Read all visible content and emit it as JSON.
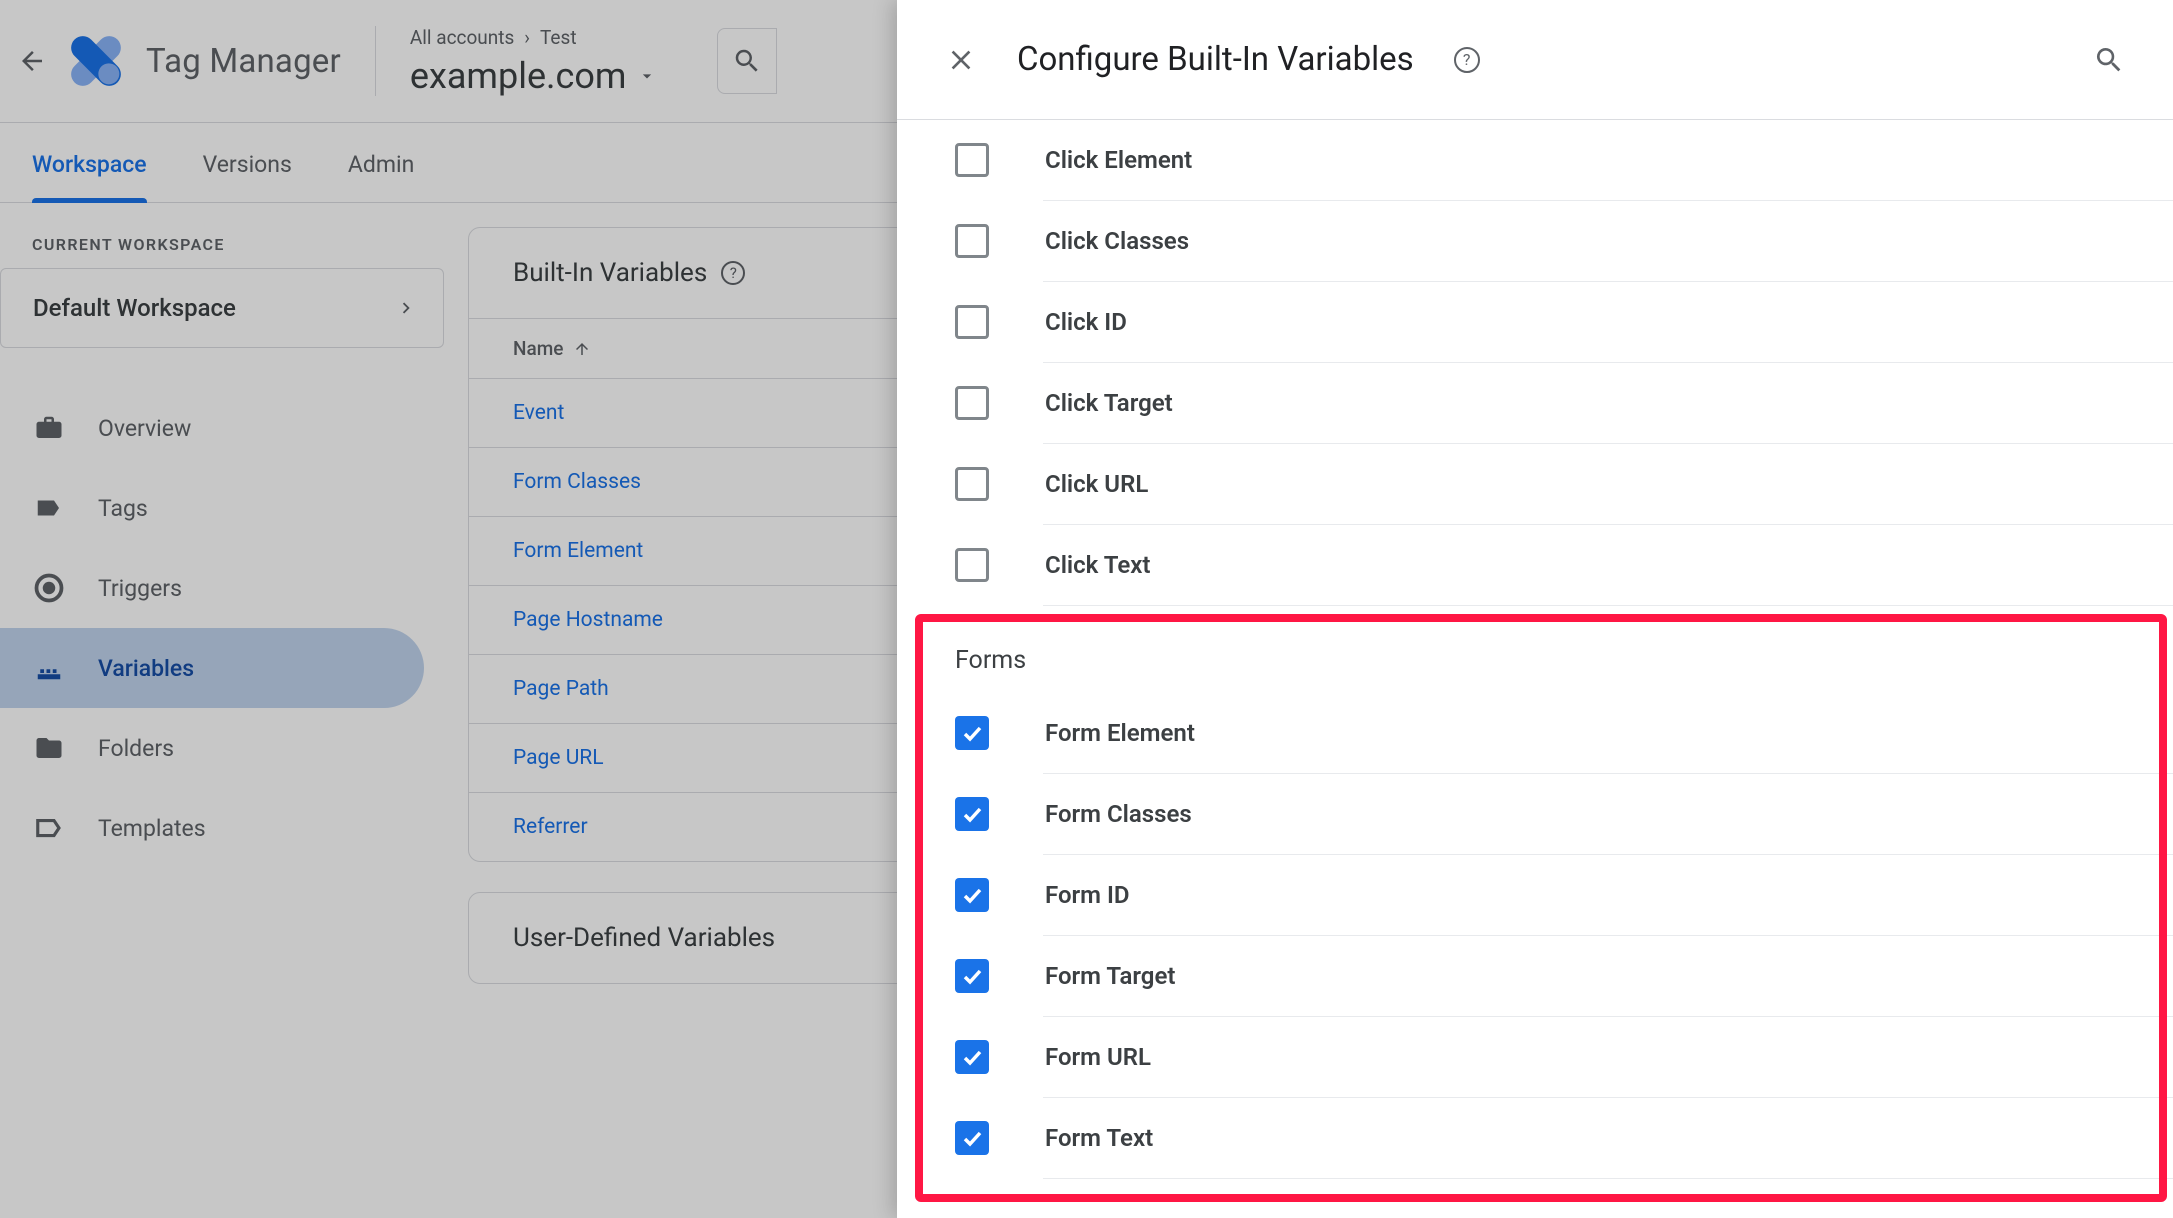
{
  "header": {
    "app_title": "Tag Manager",
    "breadcrumb1": "All accounts",
    "breadcrumb_sep": "›",
    "breadcrumb2": "Test",
    "container": "example.com"
  },
  "tabs": {
    "workspace": "Workspace",
    "versions": "Versions",
    "admin": "Admin"
  },
  "sidebar": {
    "current_workspace_label": "CURRENT WORKSPACE",
    "workspace_name": "Default Workspace",
    "items": [
      {
        "label": "Overview"
      },
      {
        "label": "Tags"
      },
      {
        "label": "Triggers"
      },
      {
        "label": "Variables"
      },
      {
        "label": "Folders"
      },
      {
        "label": "Templates"
      }
    ]
  },
  "main": {
    "built_in_title": "Built-In Variables",
    "name_header": "Name",
    "rows": [
      "Event",
      "Form Classes",
      "Form Element",
      "Page Hostname",
      "Page Path",
      "Page URL",
      "Referrer"
    ],
    "user_defined_title": "User-Defined Variables"
  },
  "panel": {
    "title": "Configure Built-In Variables",
    "click_vars": [
      {
        "label": "Click Element",
        "checked": false
      },
      {
        "label": "Click Classes",
        "checked": false
      },
      {
        "label": "Click ID",
        "checked": false
      },
      {
        "label": "Click Target",
        "checked": false
      },
      {
        "label": "Click URL",
        "checked": false
      },
      {
        "label": "Click Text",
        "checked": false
      }
    ],
    "forms_group_label": "Forms",
    "form_vars": [
      {
        "label": "Form Element",
        "checked": true
      },
      {
        "label": "Form Classes",
        "checked": true
      },
      {
        "label": "Form ID",
        "checked": true
      },
      {
        "label": "Form Target",
        "checked": true
      },
      {
        "label": "Form URL",
        "checked": true
      },
      {
        "label": "Form Text",
        "checked": true
      }
    ]
  }
}
